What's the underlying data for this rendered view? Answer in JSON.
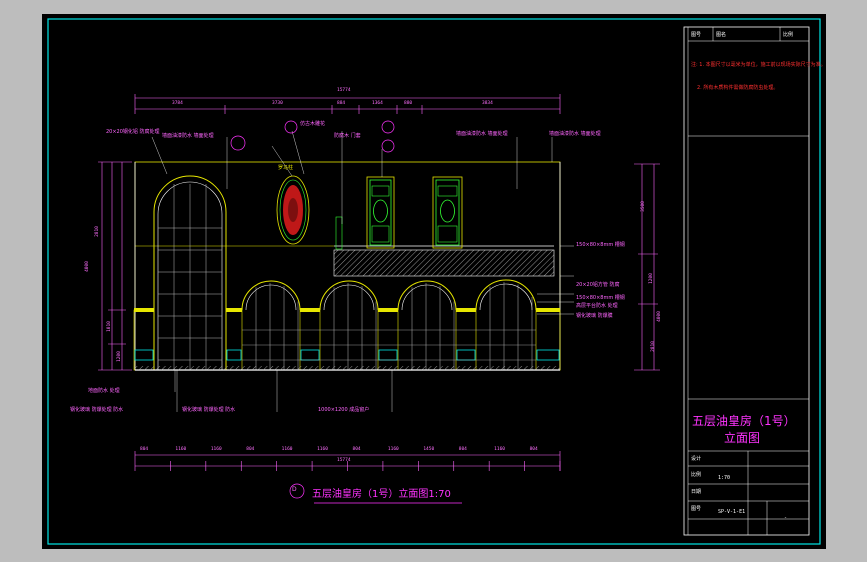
{
  "drawing": {
    "caption": "五层油皇房（1号）立面图1:70",
    "caption_tag": "D",
    "overall_dim_top": "15774",
    "overall_dim_bottom": "15774",
    "top_dims": [
      "3784",
      "3730",
      "884",
      "1364",
      "880",
      "3834"
    ],
    "bottom_dims": [
      "804",
      "1160",
      "1160",
      "804",
      "1160",
      "1160",
      "804",
      "1160",
      "1450",
      "804",
      "1160",
      "804"
    ],
    "left_dims": [
      "2810",
      "1010",
      "1200",
      "4000"
    ],
    "right_dims": [
      "3500",
      "1200",
      "4000",
      "2810"
    ],
    "annotations_top": [
      "20×20钢化铝 防腐处理",
      "墙面油漆防水 墙面处理",
      "仿古木雕花",
      "防腐木 门套",
      "墙面油漆防水 墙面处理",
      "墙面油漆防水 墙面处理"
    ],
    "annotations_right": [
      "150×80×8mm 槽钢",
      "20×20铝方管 防腐",
      "150×80×8mm 槽钢",
      "高层平台防水 处理",
      "钢化玻璃 防爆膜"
    ],
    "annotations_bottom": [
      "地面防水 处理",
      "钢化玻璃 防爆处理 防水",
      "钢化玻璃 防爆处理 防水",
      "1000×1200 成品窗户"
    ],
    "medallion_label": "罗马柱"
  },
  "title_block": {
    "header_cells": [
      "图号",
      "图名",
      "比例"
    ],
    "notes": [
      "注: 1. 本图尺寸以毫米为单位，施工前以现场实际尺寸为准。",
      "2. 所有木质构件需做防腐防虫处理。"
    ],
    "title_line1": "五层油皇房（1号）",
    "title_line2": "立面图",
    "rows": [
      {
        "label": "设计",
        "value": ""
      },
      {
        "label": "比例",
        "value": "1:70"
      },
      {
        "label": "日期",
        "value": ""
      },
      {
        "label": "图号",
        "value": "SP-V-1-E1"
      }
    ],
    "page": "-"
  },
  "colors": {
    "background": "#000000",
    "frame": "#00e5e5",
    "magenta": "#ff33ff",
    "yellow": "#e6e600",
    "green": "#33ff33",
    "red": "#ff2020",
    "white": "#ffffff"
  }
}
